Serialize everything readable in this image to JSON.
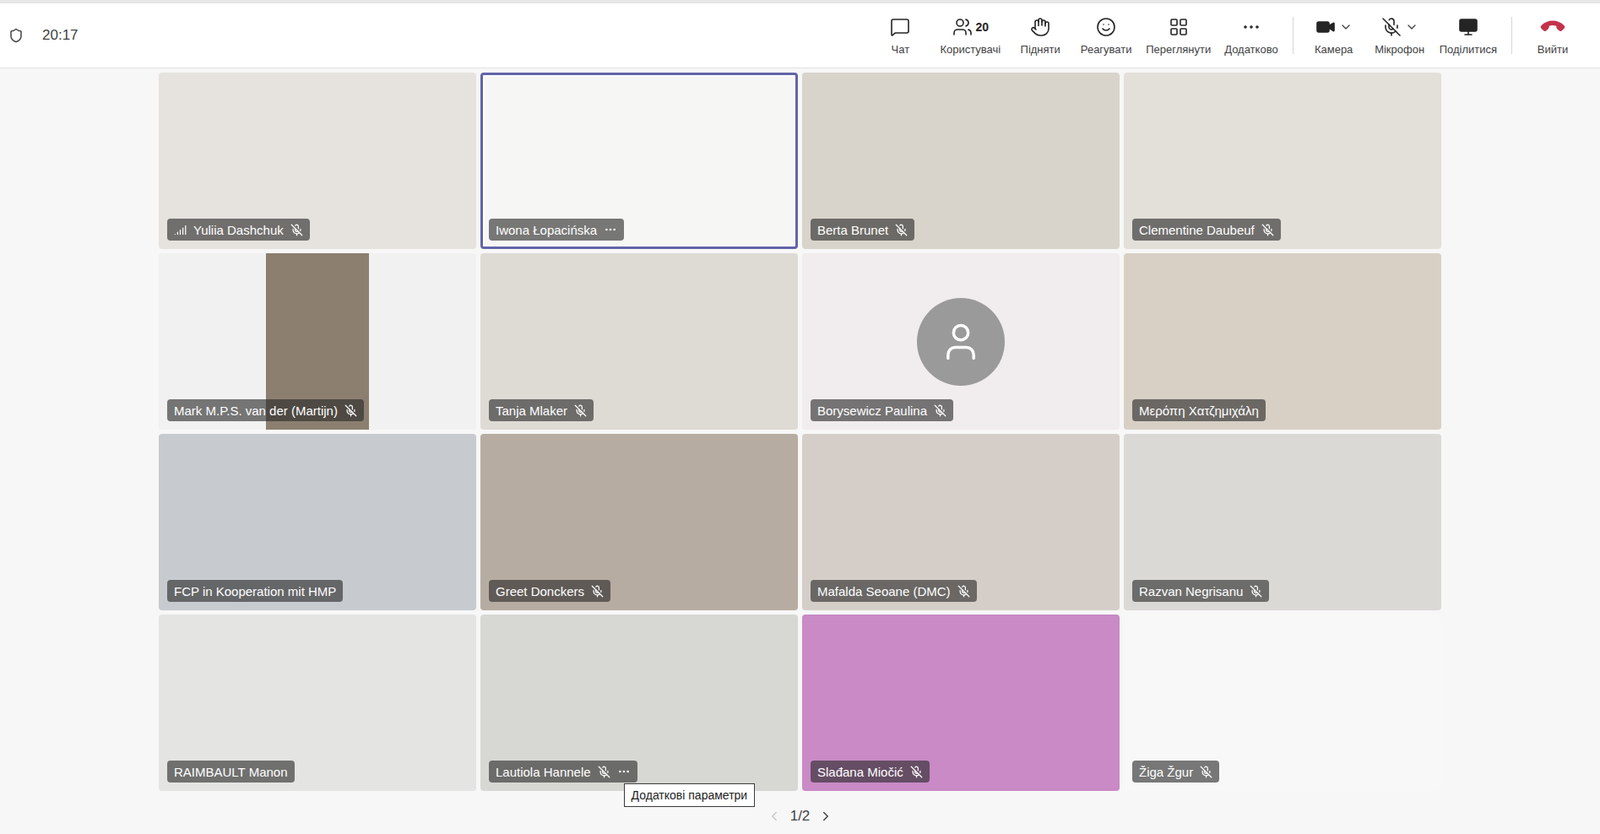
{
  "top_bar": {
    "time": "20:17",
    "toolbar": [
      {
        "label": "Чат",
        "kind": "button",
        "separator_before": false
      },
      {
        "label": "Користувачі",
        "kind": "button",
        "badge": "20",
        "separator_before": false
      },
      {
        "label": "Підняти",
        "kind": "button",
        "separator_before": false
      },
      {
        "label": "Реагувати",
        "kind": "button",
        "separator_before": false
      },
      {
        "label": "Переглянути",
        "kind": "button",
        "separator_before": false
      },
      {
        "label": "Додатково",
        "kind": "button",
        "separator_before": false
      },
      {
        "label": "Камера",
        "kind": "split",
        "separator_before": true
      },
      {
        "label": "Мікрофон",
        "kind": "split",
        "muted": true,
        "separator_before": false
      },
      {
        "label": "Поділитися",
        "kind": "button",
        "separator_before": false
      },
      {
        "label": "Вийти",
        "kind": "leave",
        "separator_before": true
      }
    ]
  },
  "tiles": [
    {
      "name": "Yuliia Dashchuk",
      "kind": "video",
      "color": "#e6e3de",
      "muted": true,
      "speaking": false,
      "more": false,
      "signal": true
    },
    {
      "name": "Iwona Łopacińska",
      "kind": "video",
      "color": "#f6f6f4",
      "muted": false,
      "speaking": true,
      "more": true,
      "signal": false
    },
    {
      "name": "Berta Brunet",
      "kind": "video",
      "color": "#d9d4cb",
      "muted": true,
      "speaking": false,
      "more": false,
      "signal": false
    },
    {
      "name": "Clementine Daubeuf",
      "kind": "video",
      "color": "#e3dfd9",
      "muted": true,
      "speaking": false,
      "more": false,
      "signal": false
    },
    {
      "name": "Mark M.P.S. van der (Martijn)",
      "kind": "portrait",
      "color": "#f1f1f1",
      "portrait_color": "#8c7f70",
      "muted": true,
      "speaking": false,
      "more": false,
      "signal": false
    },
    {
      "name": "Tanja Mlaker",
      "kind": "video",
      "color": "#dedad4",
      "muted": true,
      "speaking": false,
      "more": false,
      "signal": false
    },
    {
      "name": "Borysewicz Paulina",
      "kind": "avatar",
      "color": "#f1ecee",
      "muted": true,
      "speaking": false,
      "more": false,
      "signal": false
    },
    {
      "name": "Μερόπη Χατζημιχάλη",
      "kind": "video",
      "color": "#d8d0c5",
      "muted": false,
      "speaking": false,
      "more": false,
      "signal": false
    },
    {
      "name": "FCP in Kooperation mit HMP",
      "kind": "video",
      "color": "#c7cbcf",
      "muted": false,
      "speaking": false,
      "more": false,
      "signal": false
    },
    {
      "name": "Greet Donckers",
      "kind": "video",
      "color": "#b7aca1",
      "muted": true,
      "speaking": false,
      "more": false,
      "signal": false
    },
    {
      "name": "Mafalda Seoane (DMC)",
      "kind": "video",
      "color": "#d5cec8",
      "muted": true,
      "speaking": false,
      "more": false,
      "signal": false
    },
    {
      "name": "Razvan Negrisanu",
      "kind": "video",
      "color": "#dbd9d5",
      "muted": true,
      "speaking": false,
      "more": false,
      "signal": false
    },
    {
      "name": "RAIMBAULT Manon",
      "kind": "video",
      "color": "#e4e4e2",
      "muted": false,
      "speaking": false,
      "more": false,
      "signal": false
    },
    {
      "name": "Lautiola Hannele",
      "kind": "video",
      "color": "#d7d7d3",
      "muted": true,
      "speaking": false,
      "more": true,
      "signal": false,
      "tooltip": "Додаткові параметри"
    },
    {
      "name": "Slađana Miočić",
      "kind": "video",
      "color": "#c98ac6",
      "muted": true,
      "speaking": false,
      "more": false,
      "signal": false
    },
    {
      "name": "Žiga Žgur",
      "kind": "empty",
      "color": "#f8f8f8",
      "muted": true,
      "speaking": false,
      "more": false,
      "signal": false
    }
  ],
  "pagination": {
    "page": "1/2",
    "prev_disabled": true,
    "next_disabled": false
  }
}
